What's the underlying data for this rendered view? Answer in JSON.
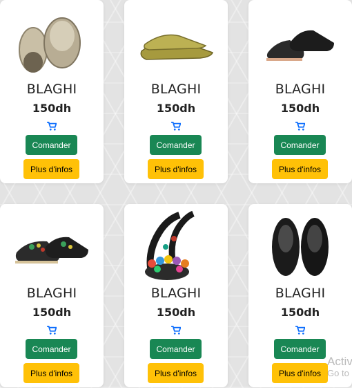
{
  "products": [
    {
      "name": "BLAGHI",
      "price": "150dh",
      "order_label": "Comander",
      "info_label": "Plus d'infos",
      "image": "straw-babouche"
    },
    {
      "name": "BLAGHI",
      "price": "150dh",
      "order_label": "Comander",
      "info_label": "Plus d'infos",
      "image": "olive-babouche"
    },
    {
      "name": "BLAGHI",
      "price": "150dh",
      "order_label": "Comander",
      "info_label": "Plus d'infos",
      "image": "black-mule"
    },
    {
      "name": "BLAGHI",
      "price": "150dh",
      "order_label": "Comander",
      "info_label": "Plus d'infos",
      "image": "embroidered-mule"
    },
    {
      "name": "BLAGHI",
      "price": "150dh",
      "order_label": "Comander",
      "info_label": "Plus d'infos",
      "image": "pompom-sandal"
    },
    {
      "name": "BLAGHI",
      "price": "150dh",
      "order_label": "Comander",
      "info_label": "Plus d'infos",
      "image": "black-leather-slipper"
    }
  ],
  "cart_icon": "cart-icon",
  "watermark": {
    "line1": "Activ",
    "line2": "Go to"
  },
  "colors": {
    "order_button": "#198754",
    "info_button": "#ffc107",
    "cart_icon": "#0d6efd",
    "background": "#e3e3e3"
  }
}
